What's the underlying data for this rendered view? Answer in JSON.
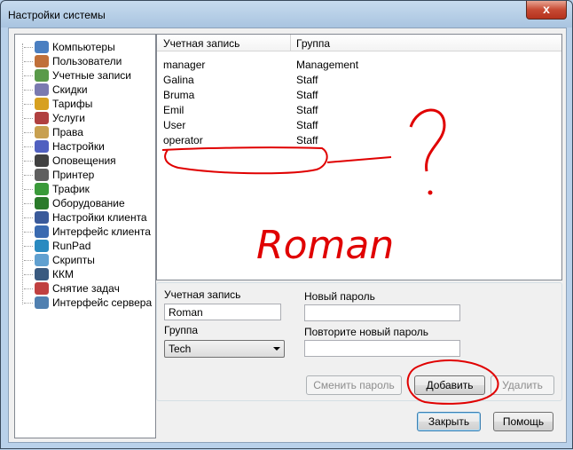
{
  "window": {
    "title": "Настройки системы",
    "close_glyph": "x"
  },
  "tree": {
    "items": [
      {
        "label": "Компьютеры",
        "icon": "computer-icon",
        "color": "#4a7fc1"
      },
      {
        "label": "Пользователи",
        "icon": "users-icon",
        "color": "#c0703a"
      },
      {
        "label": "Учетные записи",
        "icon": "accounts-icon",
        "color": "#5a9a4a"
      },
      {
        "label": "Скидки",
        "icon": "discount-icon",
        "color": "#7a7ab0"
      },
      {
        "label": "Тарифы",
        "icon": "tariff-icon",
        "color": "#d7a020"
      },
      {
        "label": "Услуги",
        "icon": "services-icon",
        "color": "#b04040"
      },
      {
        "label": "Права",
        "icon": "rights-icon",
        "color": "#c8a050"
      },
      {
        "label": "Настройки",
        "icon": "settings-icon",
        "color": "#5060c0"
      },
      {
        "label": "Оповещения",
        "icon": "notifications-icon",
        "color": "#404040"
      },
      {
        "label": "Принтер",
        "icon": "printer-icon",
        "color": "#606060"
      },
      {
        "label": "Трафик",
        "icon": "traffic-icon",
        "color": "#3a9a3a"
      },
      {
        "label": "Оборудование",
        "icon": "hardware-icon",
        "color": "#2a7a2a"
      },
      {
        "label": "Настройки клиента",
        "icon": "client-settings-icon",
        "color": "#3a5a9a"
      },
      {
        "label": "Интерфейс клиента",
        "icon": "client-interface-icon",
        "color": "#3a6ab0"
      },
      {
        "label": "RunPad",
        "icon": "runpad-icon",
        "color": "#2a8ac0"
      },
      {
        "label": "Скрипты",
        "icon": "scripts-icon",
        "color": "#60a0d0"
      },
      {
        "label": "ККМ",
        "icon": "kkm-icon",
        "color": "#3a5a80"
      },
      {
        "label": "Снятие задач",
        "icon": "tasks-icon",
        "color": "#c04040"
      },
      {
        "label": "Интерфейс сервера",
        "icon": "server-interface-icon",
        "color": "#5080b0"
      }
    ]
  },
  "accounts": {
    "columns": [
      "Учетная запись",
      "Группа"
    ],
    "rows": [
      {
        "account": "manager",
        "group": "Management"
      },
      {
        "account": "Galina",
        "group": "Staff"
      },
      {
        "account": "Bruma",
        "group": "Staff"
      },
      {
        "account": "Emil",
        "group": "Staff"
      },
      {
        "account": "User",
        "group": "Staff"
      },
      {
        "account": "operator",
        "group": "Staff"
      }
    ]
  },
  "form": {
    "account_label": "Учетная запись",
    "account_value": "Roman",
    "group_label": "Группа",
    "group_value": "Tech",
    "new_password_label": "Новый пароль",
    "new_password_value": "",
    "repeat_password_label": "Повторите новый пароль",
    "repeat_password_value": ""
  },
  "buttons": {
    "change_password": "Сменить пароль",
    "add": "Добавить",
    "delete": "Удалить",
    "close": "Закрыть",
    "help": "Помощь"
  },
  "annotations": {
    "question_mark": "?",
    "name": "Roman",
    "color": "#e00000"
  }
}
